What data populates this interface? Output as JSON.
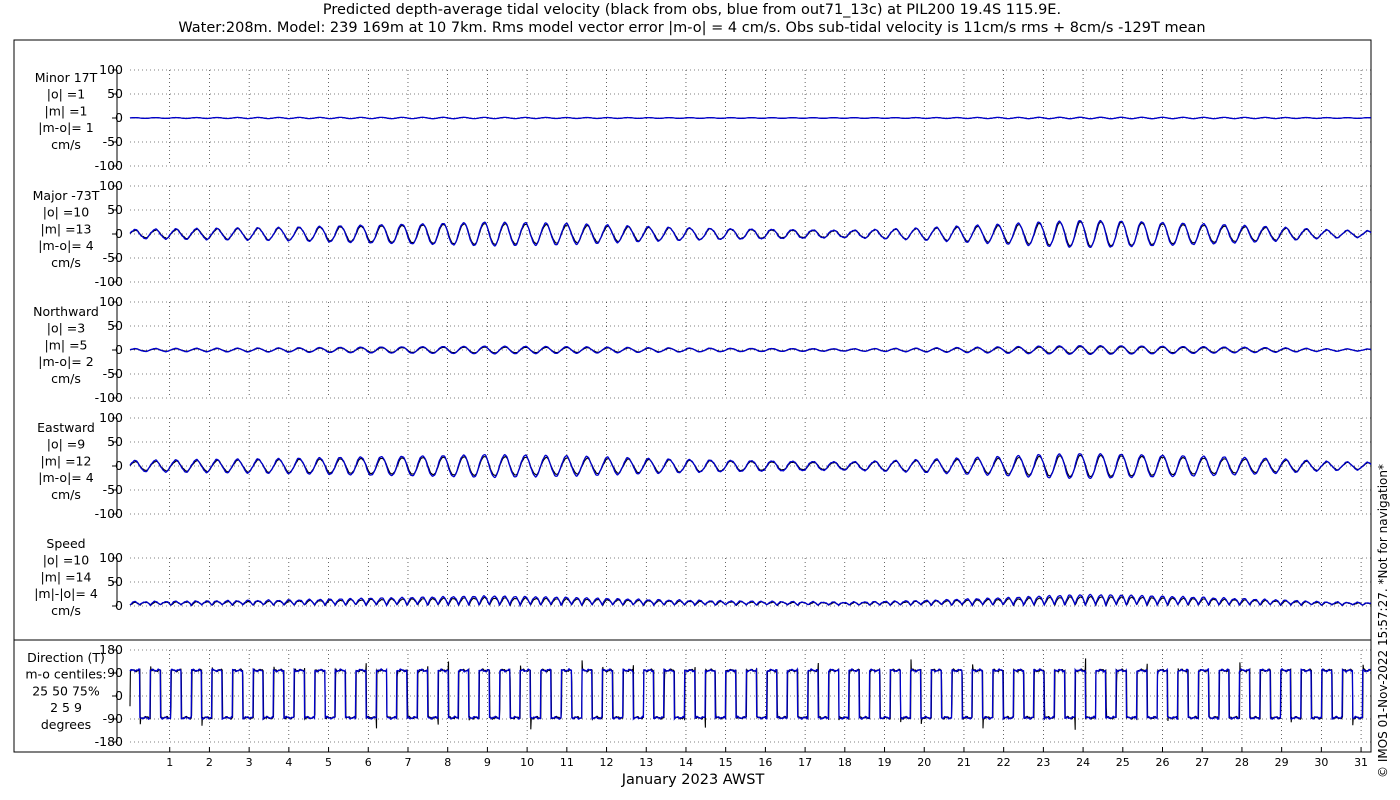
{
  "title_line1": "Predicted depth-average tidal velocity (black from obs, blue from out71_13c) at PIL200 19.4S 115.9E.",
  "title_line2": "Water:208m. Model: 239 169m at 10 7km. Rms model vector error |m-o| = 4 cm/s. Obs sub-tidal velocity is 11cm/s rms + 8cm/s -129T mean",
  "xlabel": "January 2023 AWST",
  "copyright": "© IMOS 01-Nov-2022 15:57:27.  *Not for navigation*",
  "colors": {
    "obs": "#000000",
    "model": "#0000cc",
    "grid": "#000000"
  },
  "chart_data": {
    "type": "line",
    "x_axis": {
      "label": "January 2023 AWST",
      "range_days": [
        0,
        31.25
      ],
      "ticks": [
        1,
        2,
        3,
        4,
        5,
        6,
        7,
        8,
        9,
        10,
        11,
        12,
        13,
        14,
        15,
        16,
        17,
        18,
        19,
        20,
        21,
        22,
        23,
        24,
        25,
        26,
        27,
        28,
        29,
        30,
        31
      ],
      "tick_labels": [
        "1",
        "2",
        "3",
        "4",
        "5",
        "6",
        "7",
        "8",
        "9",
        "10",
        "11",
        "12",
        "13",
        "14",
        "15",
        "16",
        "17",
        "18",
        "19",
        "20",
        "21",
        "22",
        "23",
        "24",
        "25",
        "26",
        "27",
        "28",
        "29",
        "30",
        "31"
      ]
    },
    "series_names": [
      "obs",
      "model"
    ],
    "panels": [
      {
        "key": "minor",
        "label_lines": [
          "Minor 17T",
          "|o| =1",
          "|m| =1",
          "|m-o|= 1",
          "cm/s"
        ],
        "ylim": [
          -100,
          100
        ],
        "yticks": [
          100,
          50,
          0,
          -50,
          -100
        ],
        "ytick_labels": [
          "100",
          "50",
          "0",
          "-50",
          "-100"
        ],
        "shape": "oscillation",
        "mean": 0,
        "obs_amplitude": 1,
        "model_amplitude": 1.2,
        "envelope": [
          [
            0,
            0.6
          ],
          [
            3,
            1
          ],
          [
            8,
            1.2
          ],
          [
            12,
            0.8
          ],
          [
            17,
            0.5
          ],
          [
            20,
            0.8
          ],
          [
            24,
            1.3
          ],
          [
            28,
            1.1
          ],
          [
            31.25,
            0.6
          ]
        ]
      },
      {
        "key": "major",
        "label_lines": [
          "Major -73T",
          "|o| =10",
          "|m| =13",
          "|m-o|= 4",
          "cm/s"
        ],
        "ylim": [
          -100,
          100
        ],
        "yticks": [
          100,
          50,
          0,
          -50,
          -100
        ],
        "ytick_labels": [
          "100",
          "50",
          "0",
          "-50",
          "-100"
        ],
        "shape": "oscillation",
        "mean": 0,
        "obs_amplitude": 22,
        "model_amplitude": 25,
        "envelope": [
          [
            0,
            0.35
          ],
          [
            2,
            0.45
          ],
          [
            4,
            0.55
          ],
          [
            6,
            0.75
          ],
          [
            9,
            1.0
          ],
          [
            11,
            0.85
          ],
          [
            13,
            0.6
          ],
          [
            15,
            0.45
          ],
          [
            17,
            0.35
          ],
          [
            18,
            0.3
          ],
          [
            20,
            0.5
          ],
          [
            22,
            0.8
          ],
          [
            23,
            1.0
          ],
          [
            24,
            1.15
          ],
          [
            25,
            1.1
          ],
          [
            27,
            0.85
          ],
          [
            29,
            0.55
          ],
          [
            30,
            0.35
          ],
          [
            31.25,
            0.25
          ]
        ]
      },
      {
        "key": "northward",
        "label_lines": [
          "Northward",
          "|o| =3",
          "|m| =5",
          "|m-o|= 2",
          "cm/s"
        ],
        "ylim": [
          -100,
          100
        ],
        "yticks": [
          100,
          50,
          0,
          -50,
          -100
        ],
        "ytick_labels": [
          "100",
          "50",
          "0",
          "-50",
          "-100"
        ],
        "shape": "oscillation",
        "mean": 0,
        "obs_amplitude": 6,
        "model_amplitude": 8,
        "envelope": [
          [
            0,
            0.35
          ],
          [
            2,
            0.45
          ],
          [
            4,
            0.55
          ],
          [
            6,
            0.75
          ],
          [
            9,
            1.0
          ],
          [
            11,
            0.85
          ],
          [
            13,
            0.6
          ],
          [
            15,
            0.45
          ],
          [
            17,
            0.35
          ],
          [
            18,
            0.3
          ],
          [
            20,
            0.5
          ],
          [
            22,
            0.8
          ],
          [
            23,
            1.0
          ],
          [
            24,
            1.15
          ],
          [
            25,
            1.1
          ],
          [
            27,
            0.85
          ],
          [
            29,
            0.55
          ],
          [
            30,
            0.35
          ],
          [
            31.25,
            0.25
          ]
        ]
      },
      {
        "key": "eastward",
        "label_lines": [
          "Eastward",
          "|o| =9",
          "|m| =12",
          "|m-o|= 4",
          "cm/s"
        ],
        "ylim": [
          -100,
          100
        ],
        "yticks": [
          100,
          50,
          0,
          -50,
          -100
        ],
        "ytick_labels": [
          "100",
          "50",
          "0",
          "-50",
          "-100"
        ],
        "shape": "oscillation",
        "mean": 0,
        "obs_amplitude": 20,
        "model_amplitude": 24,
        "envelope": [
          [
            0,
            0.45
          ],
          [
            2,
            0.55
          ],
          [
            4,
            0.65
          ],
          [
            6,
            0.8
          ],
          [
            9,
            1.0
          ],
          [
            11,
            0.85
          ],
          [
            13,
            0.65
          ],
          [
            15,
            0.5
          ],
          [
            17,
            0.4
          ],
          [
            18,
            0.35
          ],
          [
            20,
            0.55
          ],
          [
            22,
            0.8
          ],
          [
            23,
            1.0
          ],
          [
            24,
            1.1
          ],
          [
            25,
            1.05
          ],
          [
            27,
            0.85
          ],
          [
            29,
            0.6
          ],
          [
            30,
            0.4
          ],
          [
            31.25,
            0.3
          ]
        ]
      },
      {
        "key": "speed",
        "label_lines": [
          "Speed",
          "|o| =10",
          "|m| =14",
          "|m|-|o|= 4",
          "cm/s"
        ],
        "ylim": [
          0,
          100
        ],
        "yticks": [
          100,
          50,
          0
        ],
        "ytick_labels": [
          "100",
          "50",
          "0"
        ],
        "shape": "speed",
        "mean": 0,
        "obs_amplitude": 20,
        "model_amplitude": 25,
        "envelope": [
          [
            0,
            0.35
          ],
          [
            2,
            0.45
          ],
          [
            4,
            0.55
          ],
          [
            6,
            0.75
          ],
          [
            9,
            1.0
          ],
          [
            11,
            0.85
          ],
          [
            13,
            0.6
          ],
          [
            15,
            0.45
          ],
          [
            17,
            0.35
          ],
          [
            18,
            0.3
          ],
          [
            20,
            0.5
          ],
          [
            22,
            0.8
          ],
          [
            23,
            1.0
          ],
          [
            24,
            1.15
          ],
          [
            25,
            1.1
          ],
          [
            27,
            0.85
          ],
          [
            29,
            0.55
          ],
          [
            30,
            0.35
          ],
          [
            31.25,
            0.25
          ]
        ]
      },
      {
        "key": "direction",
        "label_lines": [
          "Direction (T)",
          "m-o centiles:",
          "25  50  75%",
          "2   5   9",
          "degrees"
        ],
        "ylim": [
          -180,
          180
        ],
        "yticks": [
          180,
          90,
          0,
          -90,
          -180
        ],
        "ytick_labels": [
          "180",
          "90",
          "0",
          "-90",
          "-180"
        ],
        "shape": "direction",
        "upper_level": 100,
        "lower_level": -85
      }
    ]
  }
}
